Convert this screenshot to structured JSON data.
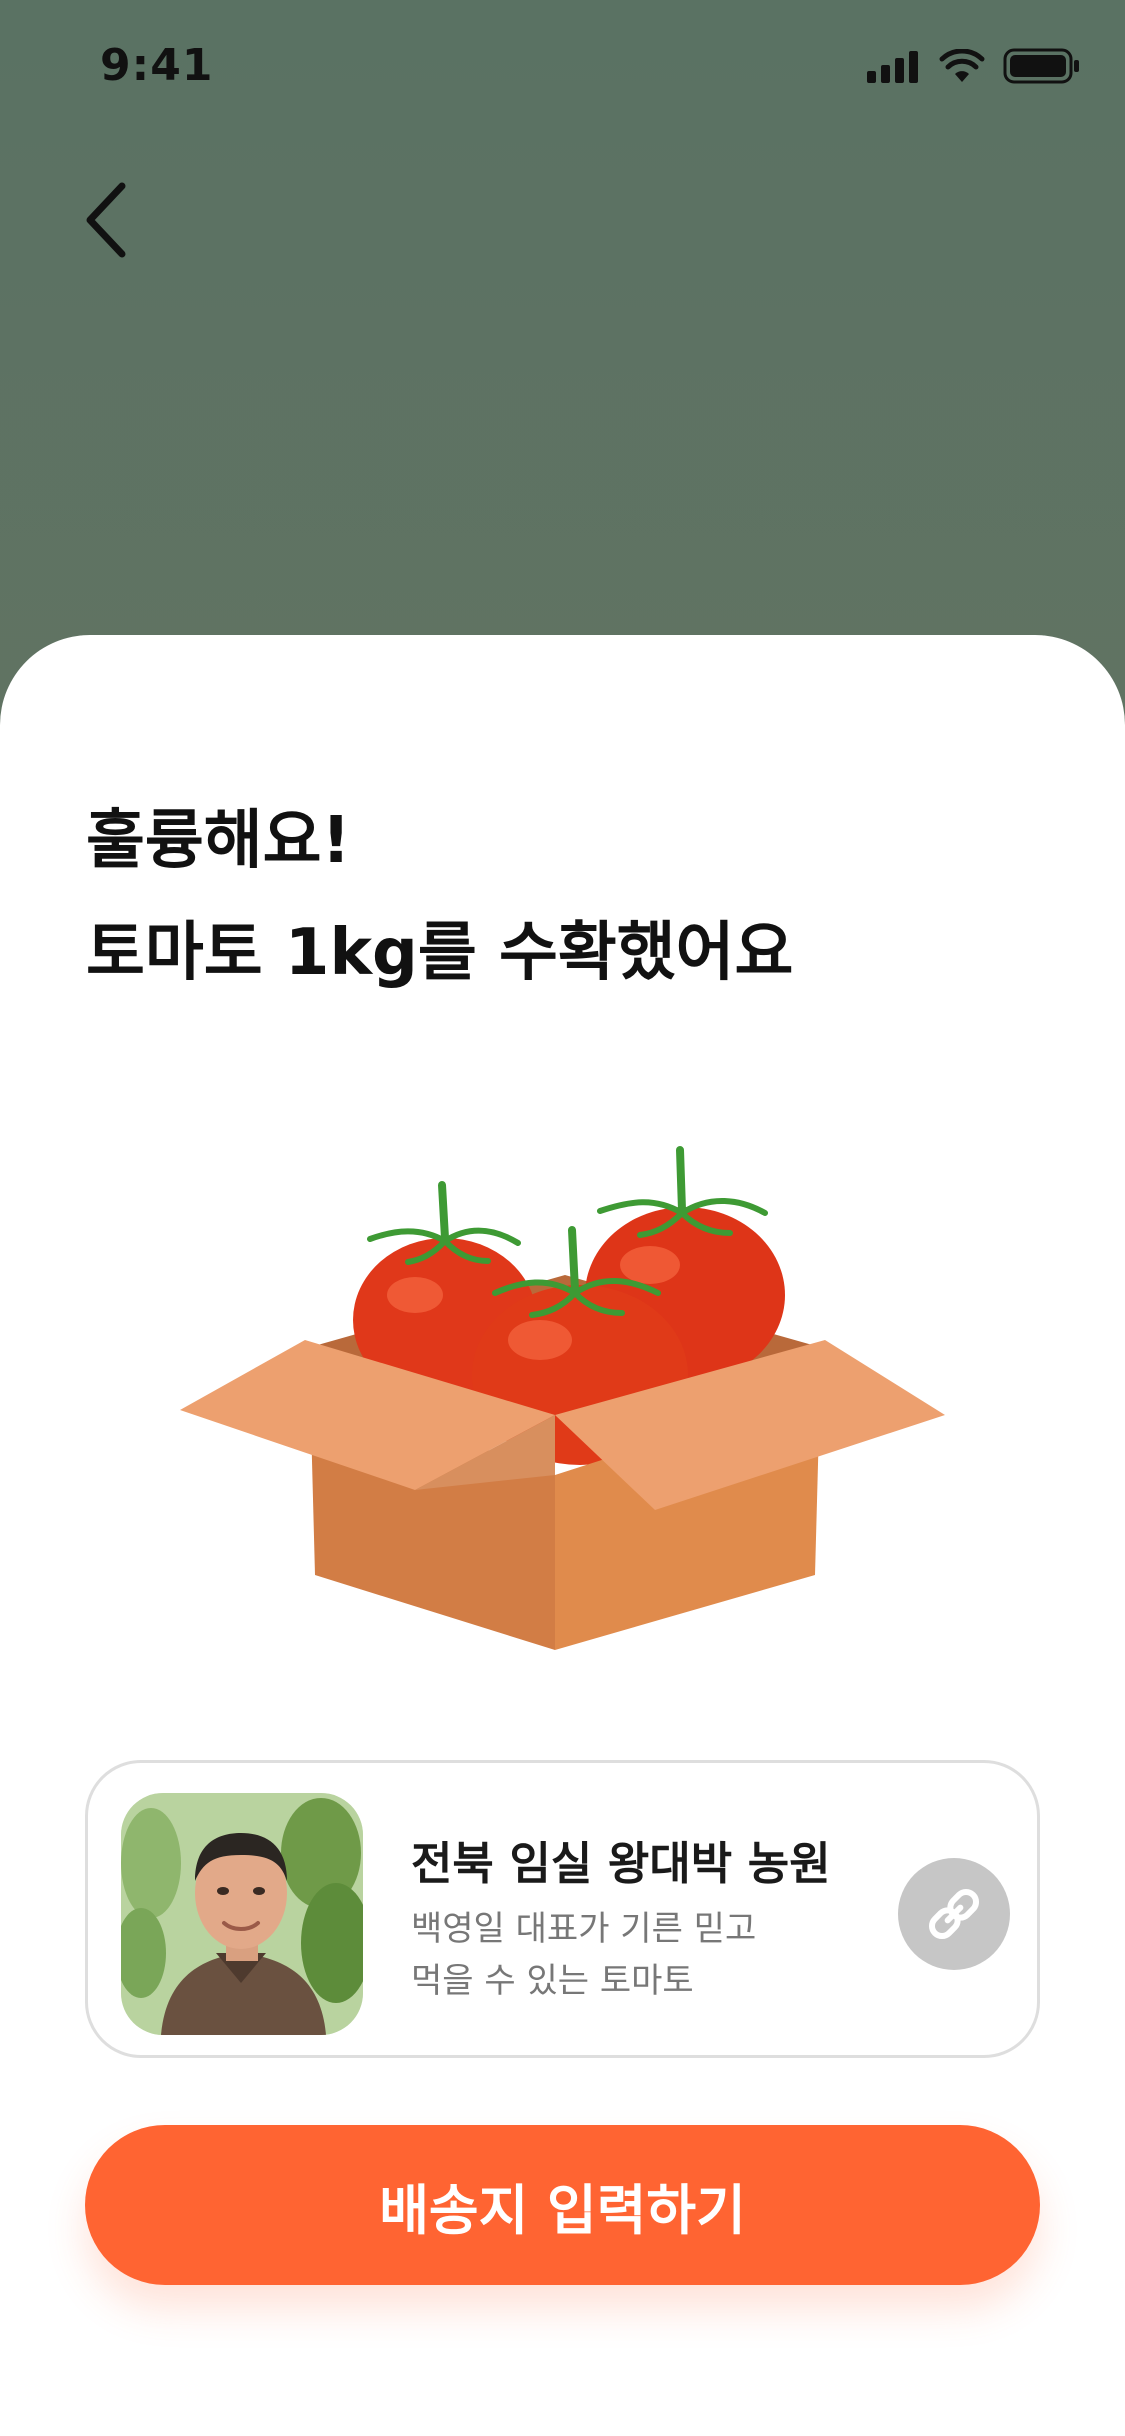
{
  "status_bar": {
    "time": "9:41"
  },
  "nav": {
    "back_icon": "chevron-left-icon"
  },
  "headline": {
    "line1": "훌륭해요!",
    "line2": "토마토 1kg를 수확했어요"
  },
  "farm_card": {
    "name": "전북 임실 왕대박 농원",
    "description_line1": "백영일 대표가 기른 믿고",
    "description_line2": "먹을 수 있는 토마토",
    "link_icon": "link-icon"
  },
  "cta": {
    "label": "배송지 입력하기"
  },
  "colors": {
    "accent": "#ff6432",
    "background_top": "#5a7263",
    "background_bottom": "#6f7562",
    "link_button": "#c6c6c6"
  }
}
